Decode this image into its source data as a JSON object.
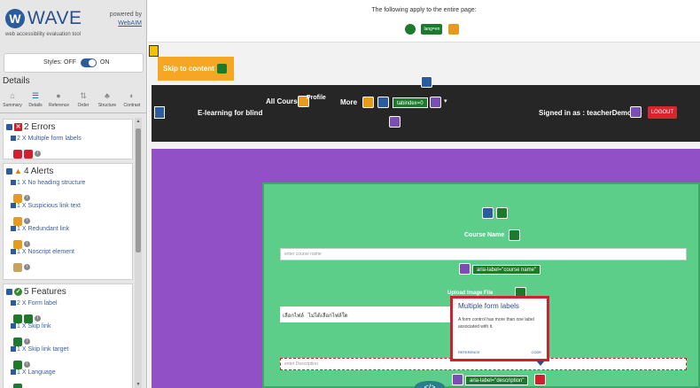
{
  "wave": {
    "logo": "WAVE",
    "tagline": "web accessibility evaluation tool",
    "powered_by": "powered by",
    "webaim": "WebAIM",
    "styles_label": "Styles:",
    "styles_off": "OFF",
    "styles_on": "ON",
    "details_heading": "Details",
    "tabs": [
      {
        "label": "Summary",
        "icon": "home-icon",
        "glyph": "⌂"
      },
      {
        "label": "Details",
        "icon": "list-icon",
        "glyph": "☰"
      },
      {
        "label": "Reference",
        "icon": "info-icon",
        "glyph": "●"
      },
      {
        "label": "Order",
        "icon": "order-icon",
        "glyph": "⇅"
      },
      {
        "label": "Structure",
        "icon": "structure-icon",
        "glyph": "♣"
      },
      {
        "label": "Contrast",
        "icon": "contrast-icon",
        "glyph": "◐"
      }
    ],
    "errors": {
      "title": "2 Errors",
      "items": [
        "2 X Multiple form labels"
      ]
    },
    "alerts": {
      "title": "4 Alerts",
      "items": [
        "1 X No heading structure",
        "1 X Suspicious link text",
        "1 X Redundant link",
        "1 X Noscript element"
      ]
    },
    "features": {
      "title": "5 Features",
      "items": [
        "2 X Form label",
        "1 X Skip link",
        "1 X Skip link target",
        "1 X Language"
      ]
    }
  },
  "page": {
    "apply_text": "The following apply to the entire page:",
    "apply_tag": "lang=en",
    "skip_link": "Skip to content",
    "brand": "E-learning for blind",
    "nav_all_courses": "All Course",
    "nav_profile": "Profile",
    "nav_more": "More",
    "tabindex_tag": "tabindex=0",
    "signed_in": "Signed in as : teacherDemo1",
    "logout": "LOGOUT",
    "course_name_label": "Course Name",
    "course_name_placeholder": "enter course name",
    "aria_course": "aria-label=\"course name\"",
    "upload_label": "Upload Image File",
    "file_button": "เลือกไฟล์",
    "file_status": "ไม่ได้เลือกไฟล์ใด",
    "description_placeholder": "enter Description",
    "aria_description": "aria-label=\"description\"",
    "code_toggle": "</>"
  },
  "popup": {
    "title": "Multiple form labels",
    "body": "A form control has more than one label associated with it.",
    "reference": "REFERENCE",
    "code": "CODE"
  },
  "colors": {
    "error": "#d0202e",
    "alert": "#e89a1c",
    "feature": "#1d7a2c",
    "aria": "#7a4fb5",
    "card": "#5dce8a",
    "section": "#9250c7",
    "navbar": "#262626"
  }
}
